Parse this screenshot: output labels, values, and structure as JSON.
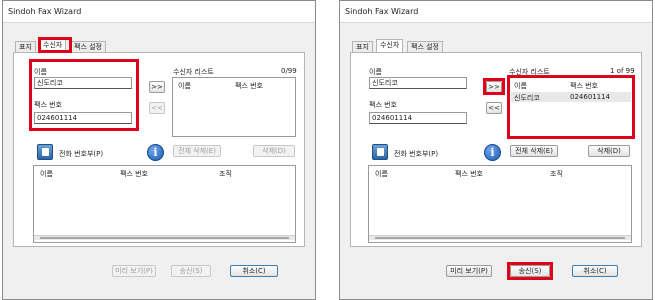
{
  "left": {
    "title": "Sindoh Fax Wizard",
    "tabs": [
      "표지",
      "수신자",
      "팩스 설정"
    ],
    "name_label": "이름",
    "name_value": "신도리코",
    "fax_label": "팩스 번호",
    "fax_value": "024601114",
    "add_btn": ">>",
    "remove_btn": "<<",
    "recipients_title": "수신자 리스트",
    "recipients_count": "0/99",
    "rec_col_name": "이름",
    "rec_col_fax": "팩스 번호",
    "phonebook_label": "전화 번호부(P)",
    "delete_all_btn": "전체 삭제(E)",
    "delete_btn": "삭제(D)",
    "pb_col_name": "이름",
    "pb_col_fax": "팩스 번호",
    "pb_col_org": "조직",
    "preview_btn": "미리 보기(P)",
    "send_btn": "송신(S)",
    "cancel_btn": "취소(C)"
  },
  "right": {
    "title": "Sindoh Fax Wizard",
    "tabs": [
      "표지",
      "수신자",
      "팩스 설정"
    ],
    "name_label": "이름",
    "name_value": "신도리코",
    "fax_label": "팩스 번호",
    "fax_value": "024601114",
    "add_btn": ">>",
    "remove_btn": "<<",
    "recipients_title": "수신자 리스트",
    "recipients_count": "1 of 99",
    "rec_col_name": "이름",
    "rec_col_fax": "팩스 번호",
    "recipient_rows": [
      {
        "name": "신도리코",
        "fax": "024601114"
      }
    ],
    "phonebook_label": "전화 번호부(P)",
    "delete_all_btn": "전체 삭제(E)",
    "delete_btn": "삭제(D)",
    "pb_col_name": "이름",
    "pb_col_fax": "팩스 번호",
    "pb_col_org": "조직",
    "preview_btn": "미리 보기(P)",
    "send_btn": "송신(S)",
    "cancel_btn": "취소(C)"
  },
  "icons": {
    "phonebook": "address-book-icon",
    "info": "info-icon"
  },
  "colors": {
    "highlight": "#e0001b",
    "info_blue": "#1c5bb5"
  }
}
